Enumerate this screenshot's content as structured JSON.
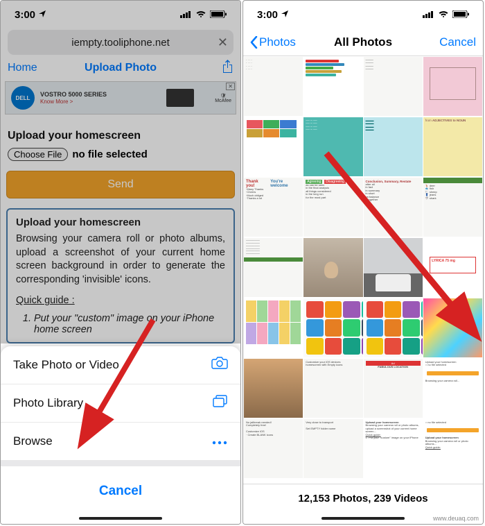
{
  "status": {
    "time": "3:00",
    "location_icon": "nav-icon"
  },
  "left": {
    "address": "iempty.tooliphone.net",
    "nav": {
      "home": "Home",
      "title": "Upload Photo"
    },
    "ad": {
      "brand": "DELL",
      "line1": "VOSTRO 5000 SERIES",
      "line2": "Know More >",
      "right": "McAfee"
    },
    "section_title": "Upload your homescreen",
    "file": {
      "button": "Choose File",
      "status": "no file selected"
    },
    "send": "Send",
    "info": {
      "heading": "Upload your homescreen",
      "body": "Browsing your camera roll or photo albums, upload a screenshot of your current home screen background in order to generate the corresponding 'invisible' icons.",
      "quick_guide_label": "Quick guide :",
      "step1": "Put your \"custom\" image on your iPhone home screen"
    },
    "sheet": {
      "take": "Take Photo or Video",
      "library": "Photo Library",
      "browse": "Browse",
      "cancel": "Cancel"
    }
  },
  "right": {
    "back": "Photos",
    "title": "All Photos",
    "cancel": "Cancel",
    "footer": "12,153 Photos, 239 Videos",
    "thumbs": {
      "t4_label": "ADJECTIVES to NOUN",
      "t5a": "Thank you!",
      "t5b": "You're welcome",
      "t6a": "Agreeing",
      "t6b": "Disagreeing",
      "t7": "Conclusion, Summary, Restate",
      "t19": "LYRICA 75 mg",
      "t22": "FABULOUS LOCATION"
    }
  },
  "watermark": "www.deuaq.com"
}
